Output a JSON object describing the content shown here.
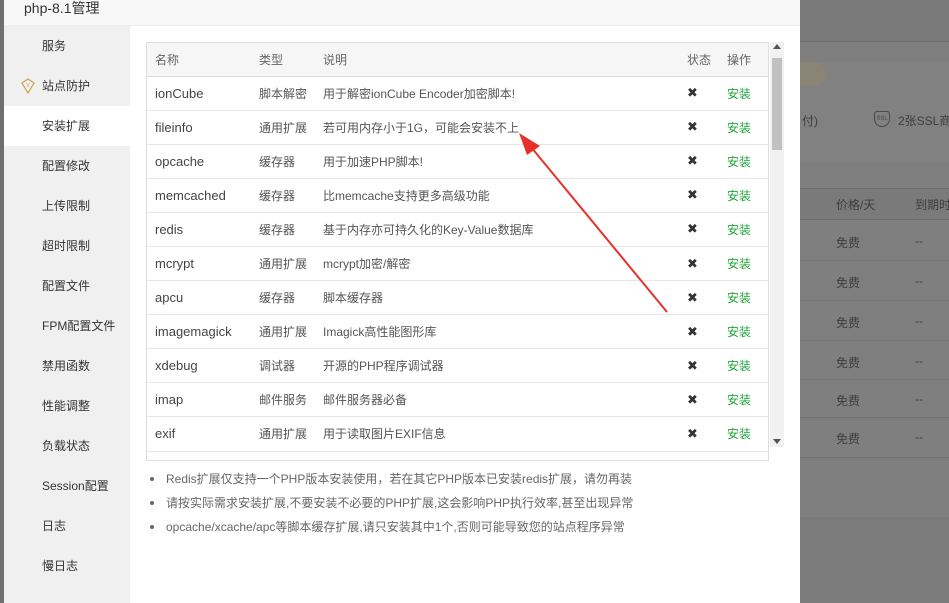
{
  "dialog": {
    "title": "php-8.1管理"
  },
  "sidebar": {
    "items": [
      {
        "label": "服务",
        "icon": ""
      },
      {
        "label": "站点防护",
        "icon": "shield-badge-icon"
      },
      {
        "label": "安装扩展",
        "icon": ""
      },
      {
        "label": "配置修改",
        "icon": ""
      },
      {
        "label": "上传限制",
        "icon": ""
      },
      {
        "label": "超时限制",
        "icon": ""
      },
      {
        "label": "配置文件",
        "icon": ""
      },
      {
        "label": "FPM配置文件",
        "icon": ""
      },
      {
        "label": "禁用函数",
        "icon": ""
      },
      {
        "label": "性能调整",
        "icon": ""
      },
      {
        "label": "负载状态",
        "icon": ""
      },
      {
        "label": "Session配置",
        "icon": ""
      },
      {
        "label": "日志",
        "icon": ""
      },
      {
        "label": "慢日志",
        "icon": ""
      }
    ],
    "active_index": 2
  },
  "table": {
    "columns": [
      "名称",
      "类型",
      "说明",
      "状态",
      "操作"
    ],
    "rows": [
      {
        "name": "ionCube",
        "type": "脚本解密",
        "desc": "用于解密ionCube Encoder加密脚本!",
        "status": "✖",
        "action": "安装"
      },
      {
        "name": "fileinfo",
        "type": "通用扩展",
        "desc": "若可用内存小于1G，可能会安装不上",
        "status": "✖",
        "action": "安装"
      },
      {
        "name": "opcache",
        "type": "缓存器",
        "desc": "用于加速PHP脚本!",
        "status": "✖",
        "action": "安装"
      },
      {
        "name": "memcached",
        "type": "缓存器",
        "desc": "比memcache支持更多高级功能",
        "status": "✖",
        "action": "安装"
      },
      {
        "name": "redis",
        "type": "缓存器",
        "desc": "基于内存亦可持久化的Key-Value数据库",
        "status": "✖",
        "action": "安装"
      },
      {
        "name": "mcrypt",
        "type": "通用扩展",
        "desc": "mcrypt加密/解密",
        "status": "✖",
        "action": "安装"
      },
      {
        "name": "apcu",
        "type": "缓存器",
        "desc": "脚本缓存器",
        "status": "✖",
        "action": "安装"
      },
      {
        "name": "imagemagick",
        "type": "通用扩展",
        "desc": "Imagick高性能图形库",
        "status": "✖",
        "action": "安装"
      },
      {
        "name": "xdebug",
        "type": "调试器",
        "desc": "开源的PHP程序调试器",
        "status": "✖",
        "action": "安装"
      },
      {
        "name": "imap",
        "type": "邮件服务",
        "desc": "邮件服务器必备",
        "status": "✖",
        "action": "安装"
      },
      {
        "name": "exif",
        "type": "通用扩展",
        "desc": "用于读取图片EXIF信息",
        "status": "✖",
        "action": "安装"
      }
    ]
  },
  "notes": [
    "Redis扩展仅支持一个PHP版本安装使用，若在其它PHP版本已安装redis扩展，请勿再装",
    "请按实际需求安装扩展,不要安装不必要的PHP扩展,这会影响PHP执行效率,甚至出现异常",
    "opcache/xcache/apc等脚本缓存扩展,请只安装其中1个,否则可能导致您的站点程序异常"
  ],
  "background": {
    "pay_fragment": "付)",
    "ssl_label": "2张SSL商",
    "ssl_icon": "ssl-shield-icon",
    "columns": [
      "价格/天",
      "到期时"
    ],
    "rows": [
      {
        "price": "免费",
        "expire": "--"
      },
      {
        "price": "免费",
        "expire": "--"
      },
      {
        "price": "免费",
        "expire": "--"
      },
      {
        "price": "免费",
        "expire": "--"
      },
      {
        "price": "免费",
        "expire": "--"
      },
      {
        "price": "免费",
        "expire": "--"
      }
    ]
  },
  "colors": {
    "install_green": "#20a53a",
    "arrow_red": "#e8302a",
    "sidebar_bg": "#f0f0f0",
    "overlay": "#7b7b7b"
  }
}
